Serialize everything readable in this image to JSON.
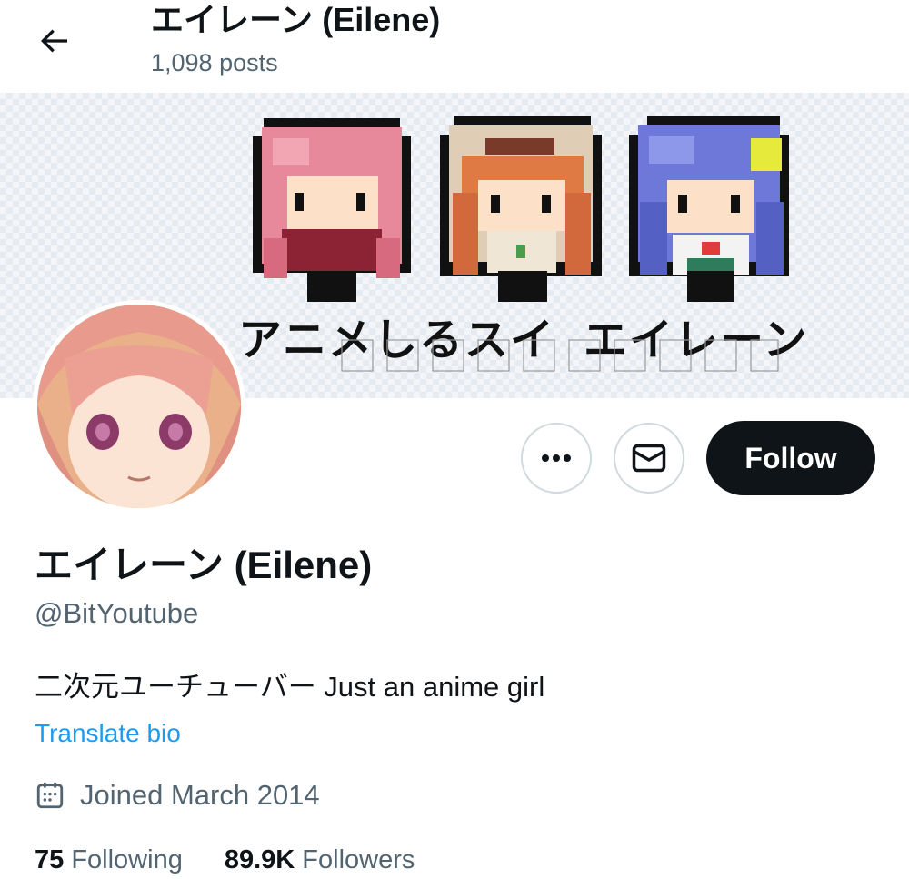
{
  "header": {
    "title": "エイレーン (Eilene)",
    "post_count": "1,098 posts"
  },
  "banner": {
    "text": "アニメしるスイ エイレーン"
  },
  "actions": {
    "follow_label": "Follow"
  },
  "profile": {
    "display_name": "エイレーン (Eilene)",
    "handle": "@BitYoutube",
    "bio": "二次元ユーチューバー Just an anime girl",
    "translate_label": "Translate bio",
    "joined": "Joined March 2014",
    "following_count": "75",
    "following_label": "Following",
    "followers_count": "89.9K",
    "followers_label": "Followers"
  },
  "icons": {
    "back": "arrow-left-icon",
    "more": "more-dots-icon",
    "message": "envelope-icon",
    "calendar": "calendar-icon"
  },
  "colors": {
    "accent_link": "#1d9bf0",
    "follow_button": "#0f1419",
    "secondary_text": "#536471"
  }
}
